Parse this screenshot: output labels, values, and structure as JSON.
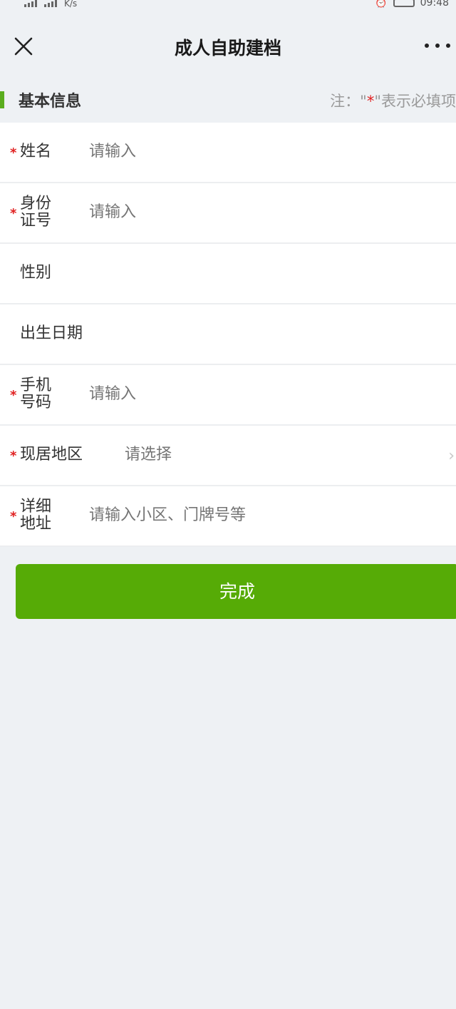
{
  "status_bar": {
    "left_text": "K/s",
    "time": "09:48"
  },
  "nav": {
    "title": "成人自助建档",
    "close_icon": "close-icon",
    "more_icon": "more-icon"
  },
  "section": {
    "title": "基本信息",
    "note_prefix": "注：\"",
    "note_star": "*",
    "note_suffix": "\"表示必填项"
  },
  "form": {
    "required_mark": "*",
    "fields": [
      {
        "label": "姓名",
        "placeholder": "请输入",
        "required": true
      },
      {
        "label": "身份证号",
        "placeholder": "请输入",
        "required": true
      },
      {
        "label": "性别",
        "placeholder": "",
        "required": false
      },
      {
        "label": "出生日期",
        "placeholder": "",
        "required": false
      },
      {
        "label": "手机号码",
        "placeholder": "请输入",
        "required": true
      },
      {
        "label": "现居地区",
        "placeholder": "请选择",
        "required": true
      },
      {
        "label": "详细地址",
        "placeholder": "请输入小区、门牌号等",
        "required": true
      }
    ],
    "chevron": "›"
  },
  "submit": {
    "label": "完成"
  },
  "colors": {
    "accent": "#56ab06",
    "required": "#e02020",
    "background": "#eef1f4"
  }
}
